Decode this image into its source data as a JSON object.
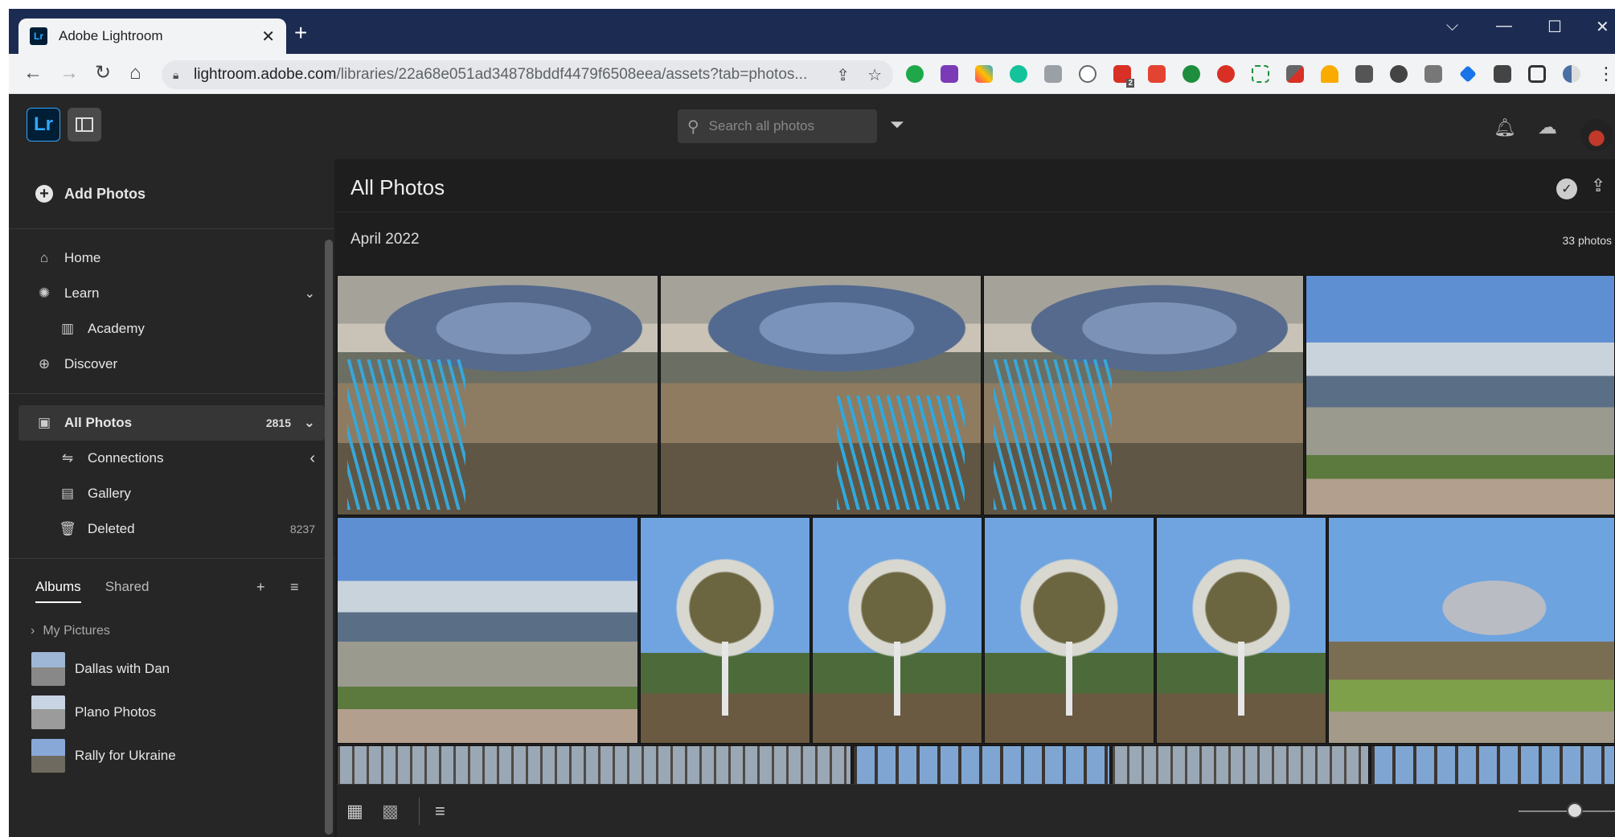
{
  "browser": {
    "tab_title": "Adobe Lightroom",
    "tab_close": "✕",
    "new_tab": "+",
    "url_host": "lightroom.adobe.com",
    "url_path": "/libraries/22a68e051ad34878bddf4479f6508eea/assets?tab=photos...",
    "ext_badge": "2"
  },
  "header": {
    "logo": "Lr",
    "search_placeholder": "Search all photos"
  },
  "sidebar": {
    "add_photos": "Add Photos",
    "home": "Home",
    "learn": "Learn",
    "academy": "Academy",
    "discover": "Discover",
    "all_photos": "All Photos",
    "all_photos_count": "2815",
    "connections": "Connections",
    "gallery": "Gallery",
    "deleted": "Deleted",
    "deleted_count": "8237",
    "tabs": {
      "albums": "Albums",
      "shared": "Shared"
    },
    "my_pictures": "My Pictures",
    "albums": [
      {
        "label": "Dallas with Dan"
      },
      {
        "label": "Plano Photos"
      },
      {
        "label": "Rally for Ukraine"
      }
    ]
  },
  "main": {
    "title": "All Photos",
    "date_header": "April 2022",
    "photo_count": "33 photos"
  },
  "colors": {
    "accent": "#31a8ff",
    "chrome_bg": "#1b2b51",
    "app_bg": "#1e1e1e"
  }
}
